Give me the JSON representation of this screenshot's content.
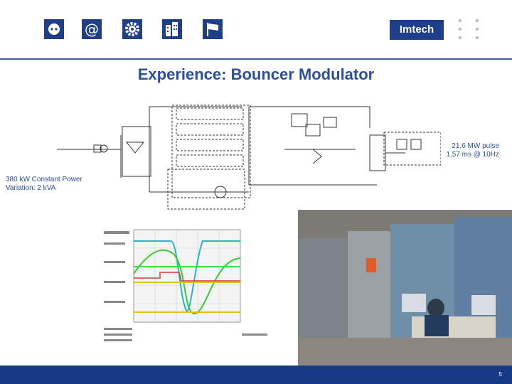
{
  "header": {
    "icons": [
      "plug-icon",
      "at-sign-icon",
      "gear-icon",
      "buildings-icon",
      "flag-icon"
    ],
    "logo_text": "Imtech",
    "brand_color": "#1f3f8a"
  },
  "slide": {
    "title": "Experience: Bouncer Modulator",
    "pulse_note_line1": "21,6 MW pulse",
    "pulse_note_line2": "1,57 ms @ 10Hz",
    "power_note_line1": "380 kW Constant Power",
    "power_note_line2": "Variation: 2 kVA",
    "page_number": "5"
  },
  "colors": {
    "title": "#2c4f9a",
    "footer": "#163a86"
  }
}
